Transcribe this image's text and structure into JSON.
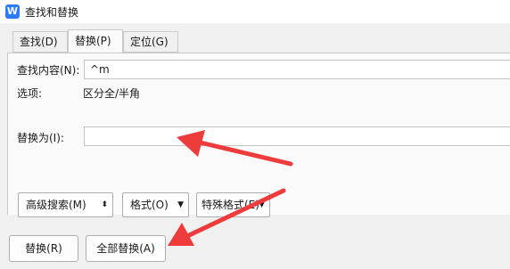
{
  "window": {
    "title": "查找和替换",
    "app_icon_letter": "W"
  },
  "tabs": [
    {
      "label": "查找(D)"
    },
    {
      "label": "替换(P)"
    },
    {
      "label": "定位(G)"
    }
  ],
  "find": {
    "label": "查找内容(N):",
    "value": "^m"
  },
  "options": {
    "label": "选项:",
    "value": "区分全/半角"
  },
  "replace": {
    "label": "替换为(I):",
    "value": ""
  },
  "buttons": {
    "advanced_search": "高级搜索(M)",
    "format": "格式(O)",
    "special_format": "特殊格式(E)",
    "replace": "替换(R)",
    "replace_all": "全部替换(A)"
  },
  "colors": {
    "annotation_arrow": "#ee3b3b",
    "app_icon": "#2c7cf6"
  }
}
